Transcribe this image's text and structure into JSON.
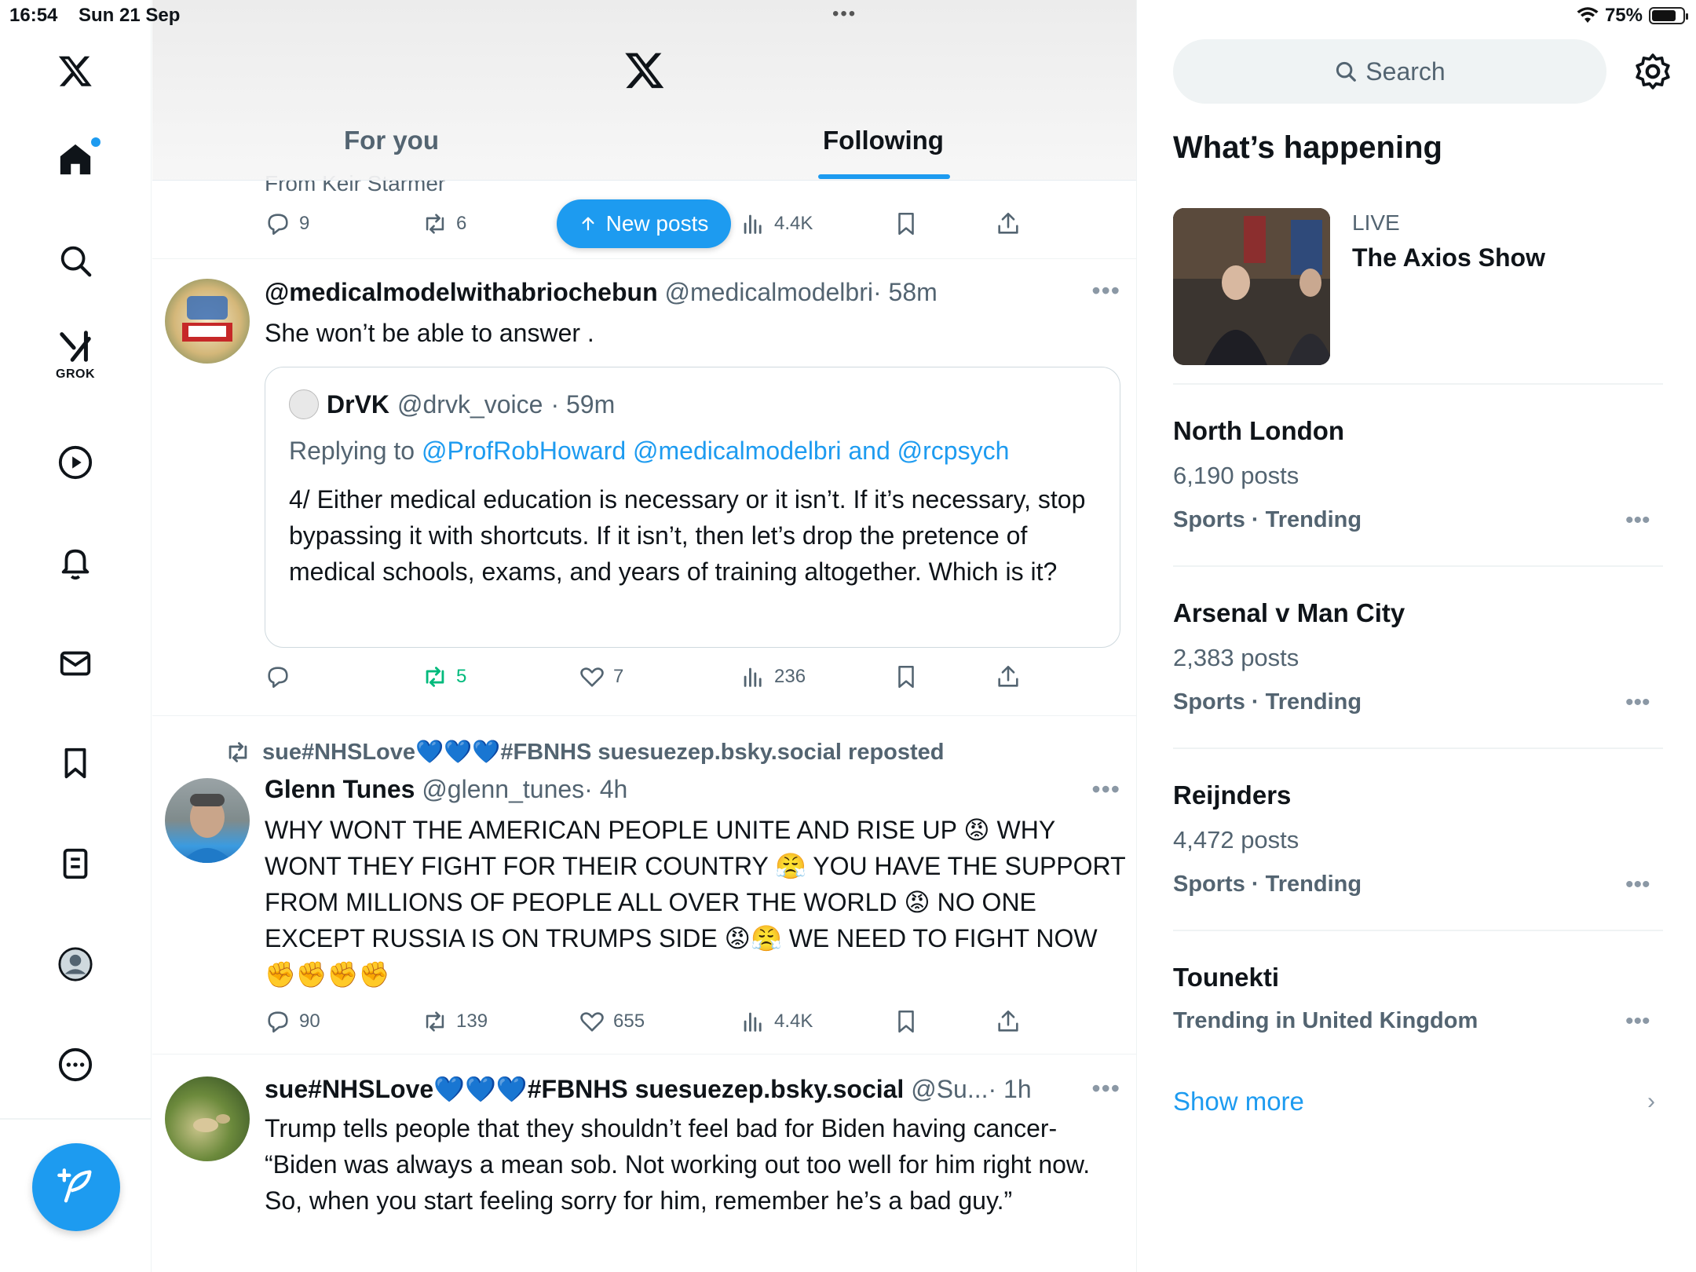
{
  "status": {
    "time": "16:54",
    "date": "Sun 21 Sep",
    "dots": "•••",
    "battery": "75%"
  },
  "nav": {
    "grok_label": "GROK"
  },
  "header": {
    "tabs": [
      "For you",
      "Following"
    ]
  },
  "feed": {
    "partial_text": "From Keir Starmer",
    "top_actions": {
      "replies": "9",
      "reposts": "6",
      "views": "4.4K"
    },
    "new_posts_label": "New posts",
    "tweet1": {
      "name": "@medicalmodelwithabriochebun",
      "handle": "@medicalmodelbri",
      "time": "· 58m",
      "text": "She won’t be able to answer .",
      "quote": {
        "name": "DrVK",
        "handle": "@drvk_voice",
        "time": "· 59m",
        "replying_prefix": "Replying to",
        "replying_to": "@ProfRobHoward @medicalmodelbri and @rcpsych",
        "text": "4/ Either medical education is necessary or it isn’t. If it’s necessary, stop bypassing it with shortcuts. If it isn’t, then let’s drop the pretence of medical schools, exams, and years of training altogether. Which is it?"
      },
      "reposts": "5",
      "likes": "7",
      "views": "236"
    },
    "tweet2": {
      "repost_line": "sue#NHSLove💙💙💙#FBNHS suesuezep.bsky.social reposted",
      "name": "Glenn Tunes",
      "handle": "@glenn_tunes",
      "time": "· 4h",
      "text": "WHY WONT THE AMERICAN PEOPLE UNITE AND RISE UP 😡 WHY WONT THEY FIGHT FOR THEIR COUNTRY 😤 YOU HAVE THE SUPPORT FROM MILLIONS OF PEOPLE ALL OVER THE WORLD 😡 NO ONE EXCEPT RUSSIA IS ON TRUMPS SIDE 😡😤 WE NEED TO FIGHT NOW ✊✊✊✊",
      "replies": "90",
      "reposts": "139",
      "likes": "655",
      "views": "4.4K"
    },
    "tweet3": {
      "name": "sue#NHSLove💙💙💙#FBNHS suesuezep.bsky.social",
      "handle": "@Su...",
      "time": "· 1h",
      "text": "Trump tells people that they shouldn’t feel bad for Biden having cancer- “Biden was always a mean sob. Not working out too well for him right now. So, when you start feeling sorry for him, remember he’s a bad guy.”"
    }
  },
  "sidebar": {
    "search_placeholder": "Search",
    "section_title": "What’s happening",
    "live": {
      "label": "LIVE",
      "title": "The Axios Show"
    },
    "trends": [
      {
        "name": "North London",
        "count": "6,190 posts",
        "category": "Sports · Trending"
      },
      {
        "name": "Arsenal v Man City",
        "count": "2,383 posts",
        "category": "Sports · Trending"
      },
      {
        "name": "Reijnders",
        "count": "4,472 posts",
        "category": "Sports · Trending"
      },
      {
        "name": "Tounekti",
        "count": "",
        "category": "Trending in United Kingdom"
      }
    ],
    "show_more": "Show more"
  },
  "colors": {
    "accent": "#1d9bf0",
    "repost_green": "#00ba7c",
    "secondary_text": "#536471"
  }
}
